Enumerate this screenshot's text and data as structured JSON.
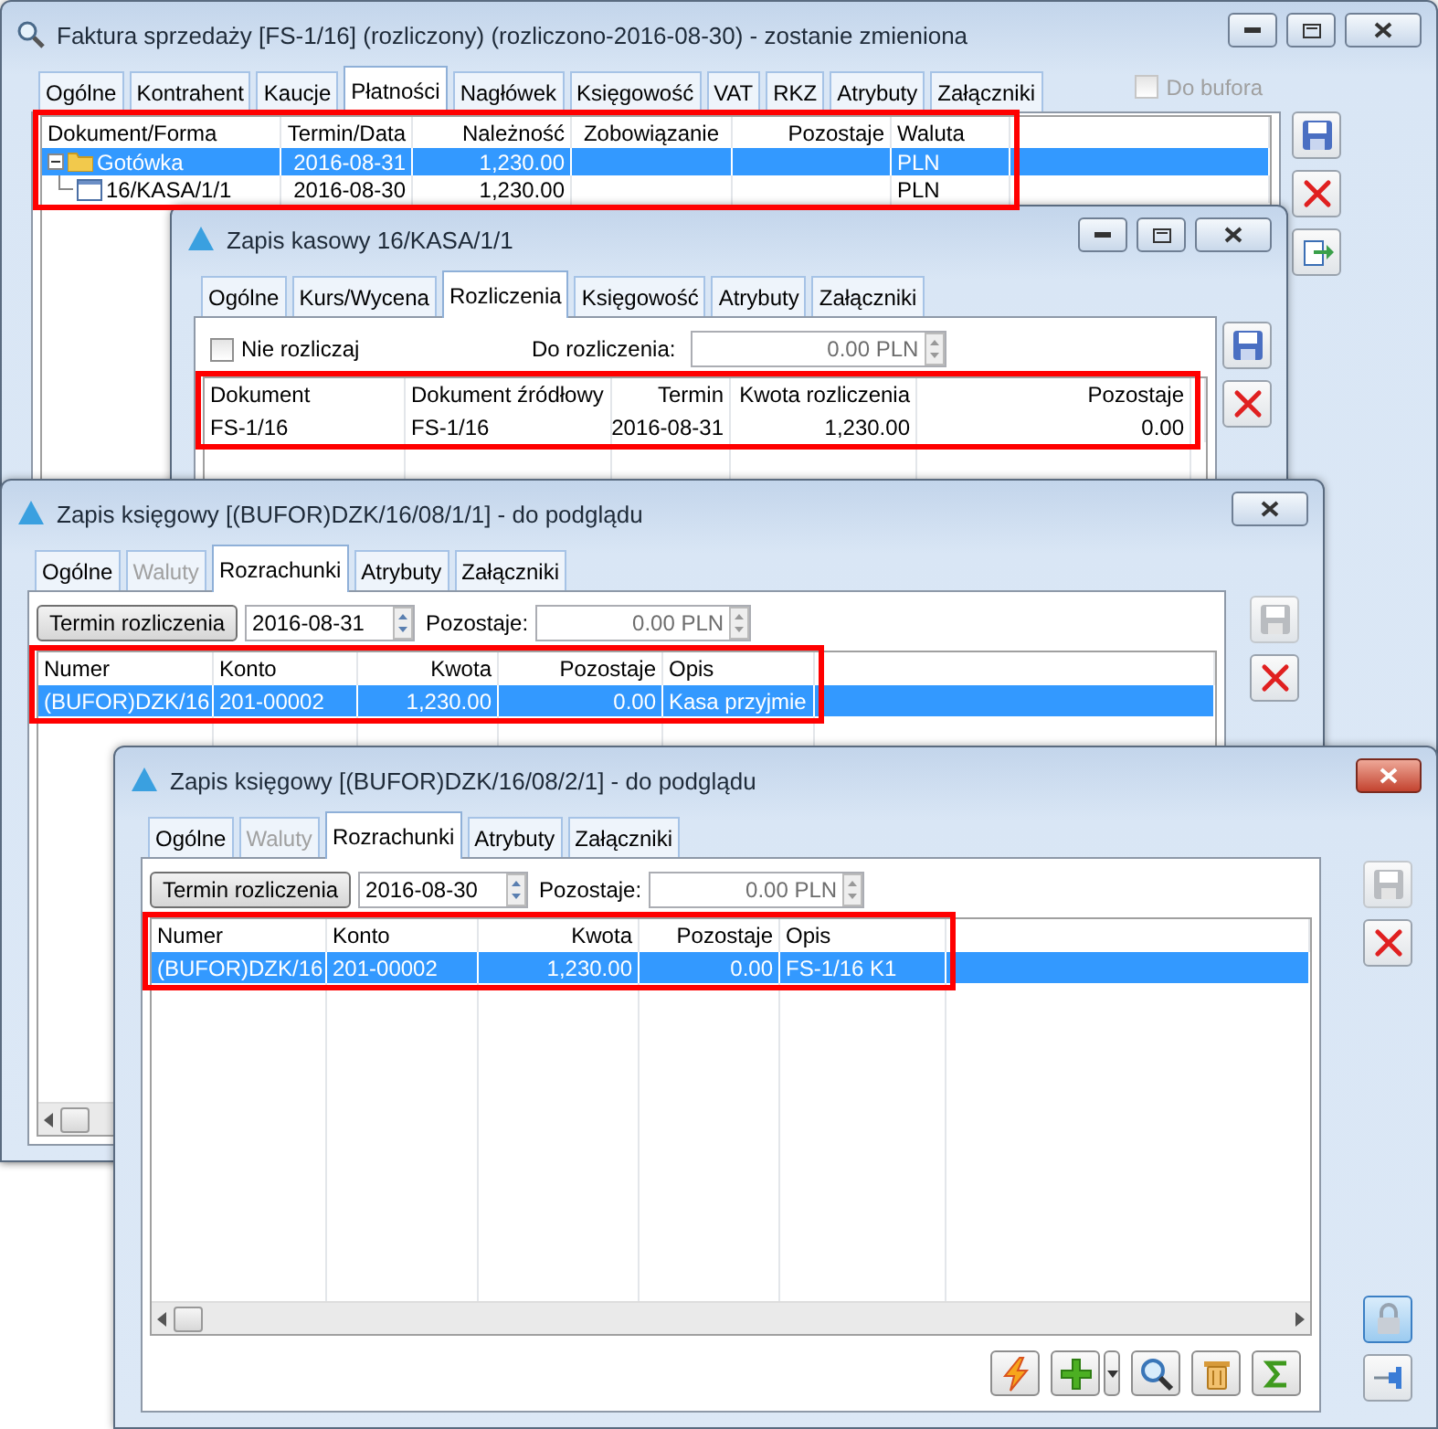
{
  "windows": [
    {
      "kind": "invoice",
      "title": "Faktura sprzedaży [FS-1/16] (rozliczony) (rozliczono-2016-08-30) - zostanie zmieniona",
      "active": false,
      "tabs": [
        {
          "label": "Ogólne",
          "selected": false,
          "disabled": false
        },
        {
          "label": "Kontrahent",
          "selected": false,
          "disabled": false
        },
        {
          "label": "Kaucje",
          "selected": false,
          "disabled": false
        },
        {
          "label": "Płatności",
          "selected": true,
          "disabled": false
        },
        {
          "label": "Nagłówek",
          "selected": false,
          "disabled": false
        },
        {
          "label": "Księgowość",
          "selected": false,
          "disabled": false
        },
        {
          "label": "VAT",
          "selected": false,
          "disabled": false
        },
        {
          "label": "RKZ",
          "selected": false,
          "disabled": false
        },
        {
          "label": "Atrybuty",
          "selected": false,
          "disabled": false
        },
        {
          "label": "Załączniki",
          "selected": false,
          "disabled": false
        }
      ],
      "buffer_option": {
        "label": "Do bufora",
        "checked": false,
        "disabled": true
      },
      "table": {
        "highlighted": true,
        "columns": [
          "Dokument/Forma",
          "Termin/Data",
          "Należność",
          "Zobowiązanie",
          "Pozostaje",
          "Waluta"
        ],
        "rows": [
          {
            "kind": "folder",
            "expanded": true,
            "selected": true,
            "cells": [
              "Gotówka",
              "2016-08-31",
              "1,230.00",
              null,
              null,
              "PLN"
            ],
            "children": [
              {
                "kind": "document",
                "selected": false,
                "cells": [
                  "16/KASA/1/1",
                  "2016-08-30",
                  "1,230.00",
                  null,
                  null,
                  "PLN"
                ]
              }
            ]
          }
        ]
      },
      "side_buttons": [
        {
          "kind": "save",
          "disabled": false,
          "pressed": false
        },
        {
          "kind": "delete",
          "disabled": false,
          "pressed": false
        },
        {
          "kind": "export",
          "disabled": false,
          "pressed": false
        }
      ]
    },
    {
      "kind": "cash",
      "title": "Zapis kasowy 16/KASA/1/1",
      "active": false,
      "tabs": [
        {
          "label": "Ogólne",
          "selected": false,
          "disabled": false
        },
        {
          "label": "Kurs/Wycena",
          "selected": false,
          "disabled": false
        },
        {
          "label": "Rozliczenia",
          "selected": true,
          "disabled": false
        },
        {
          "label": "Księgowość",
          "selected": false,
          "disabled": false
        },
        {
          "label": "Atrybuty",
          "selected": false,
          "disabled": false
        },
        {
          "label": "Załączniki",
          "selected": false,
          "disabled": false
        }
      ],
      "settle_option": {
        "label": "Nie rozliczaj",
        "checked": false
      },
      "amount_field": {
        "label": "Do rozliczenia:",
        "value": "0.00 PLN"
      },
      "table": {
        "highlighted": true,
        "columns": [
          "Dokument",
          "Dokument źródłowy",
          "Termin",
          "Kwota rozliczenia",
          "Pozostaje"
        ],
        "rows": [
          {
            "kind": "plain",
            "selected": false,
            "cells": [
              "FS-1/16",
              "FS-1/16",
              "2016-08-31",
              "1,230.00",
              "0.00"
            ]
          }
        ]
      },
      "side_buttons": [
        {
          "kind": "save",
          "disabled": false,
          "pressed": false
        },
        {
          "kind": "delete",
          "disabled": false,
          "pressed": false
        }
      ]
    },
    {
      "kind": "ledger",
      "title": "Zapis księgowy [(BUFOR)DZK/16/08/1/1] - do podglądu",
      "active": false,
      "tabs": [
        {
          "label": "Ogólne",
          "selected": false,
          "disabled": false
        },
        {
          "label": "Waluty",
          "selected": false,
          "disabled": true
        },
        {
          "label": "Rozrachunki",
          "selected": true,
          "disabled": false
        },
        {
          "label": "Atrybuty",
          "selected": false,
          "disabled": false
        },
        {
          "label": "Załączniki",
          "selected": false,
          "disabled": false
        }
      ],
      "date_button": "Termin rozliczenia",
      "date_field": {
        "value": "2016-08-31"
      },
      "remaining_field": {
        "label": "Pozostaje:",
        "value": "0.00 PLN"
      },
      "table": {
        "highlighted": true,
        "columns": [
          "Numer",
          "Konto",
          "Kwota",
          "Pozostaje",
          "Opis"
        ],
        "rows": [
          {
            "kind": "plain",
            "selected": true,
            "cells": [
              "(BUFOR)DZK/16",
              "201-00002",
              "1,230.00",
              "0.00",
              "Kasa przyjmie"
            ]
          }
        ]
      },
      "side_buttons": [
        {
          "kind": "save",
          "disabled": true,
          "pressed": false
        },
        {
          "kind": "delete",
          "disabled": false,
          "pressed": false
        }
      ]
    },
    {
      "kind": "ledger",
      "title": "Zapis księgowy [(BUFOR)DZK/16/08/2/1] - do podglądu",
      "active": true,
      "tabs": [
        {
          "label": "Ogólne",
          "selected": false,
          "disabled": false
        },
        {
          "label": "Waluty",
          "selected": false,
          "disabled": true
        },
        {
          "label": "Rozrachunki",
          "selected": true,
          "disabled": false
        },
        {
          "label": "Atrybuty",
          "selected": false,
          "disabled": false
        },
        {
          "label": "Załączniki",
          "selected": false,
          "disabled": false
        }
      ],
      "date_button": "Termin rozliczenia",
      "date_field": {
        "value": "2016-08-30"
      },
      "remaining_field": {
        "label": "Pozostaje:",
        "value": "0.00 PLN"
      },
      "table": {
        "highlighted": true,
        "columns": [
          "Numer",
          "Konto",
          "Kwota",
          "Pozostaje",
          "Opis"
        ],
        "rows": [
          {
            "kind": "plain",
            "selected": true,
            "cells": [
              "(BUFOR)DZK/16",
              "201-00002",
              "1,230.00",
              "0.00",
              "FS-1/16 K1"
            ]
          }
        ]
      },
      "toolbar": [
        {
          "kind": "lightning"
        },
        {
          "kind": "add"
        },
        {
          "kind": "dropdown"
        },
        {
          "kind": "search"
        },
        {
          "kind": "trash"
        },
        {
          "kind": "sum"
        }
      ],
      "side_buttons": [
        {
          "kind": "save",
          "disabled": true,
          "pressed": false
        },
        {
          "kind": "delete",
          "disabled": false,
          "pressed": false
        },
        {
          "kind": "lock",
          "disabled": false,
          "pressed": true
        },
        {
          "kind": "pin",
          "disabled": false,
          "pressed": false
        }
      ]
    }
  ]
}
